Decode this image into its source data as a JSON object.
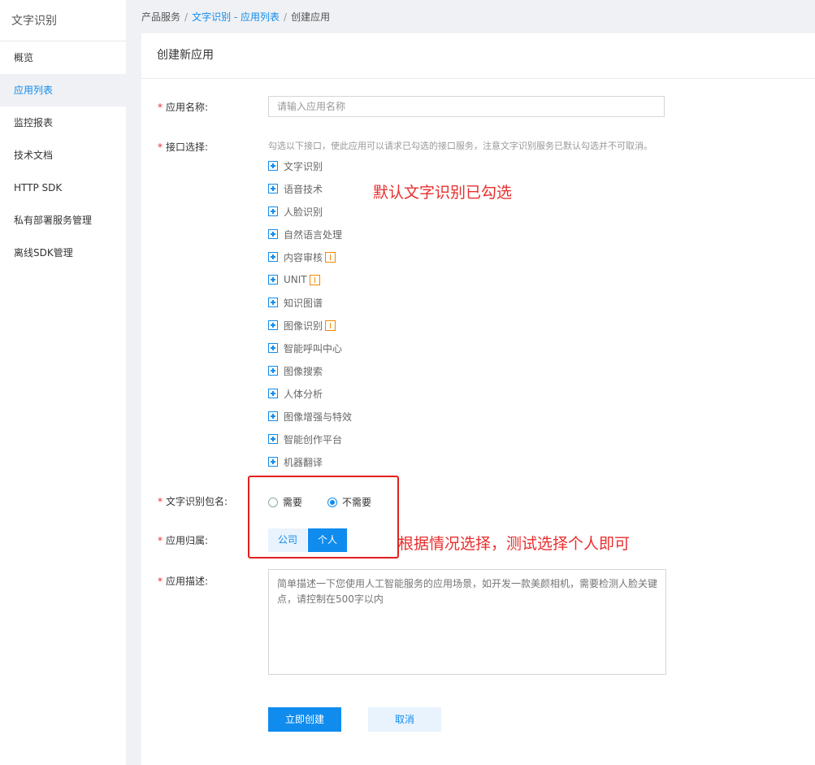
{
  "sidebar": {
    "title": "文字识别",
    "items": [
      {
        "label": "概览"
      },
      {
        "label": "应用列表"
      },
      {
        "label": "监控报表"
      },
      {
        "label": "技术文档"
      },
      {
        "label": "HTTP SDK"
      },
      {
        "label": "私有部署服务管理"
      },
      {
        "label": "离线SDK管理"
      }
    ],
    "active_index": 1
  },
  "breadcrumb": {
    "root": "产品服务",
    "link": "文字识别 - 应用列表",
    "current": "创建应用"
  },
  "form": {
    "title": "创建新应用",
    "app_name": {
      "label": "应用名称:",
      "placeholder": "请输入应用名称",
      "value": ""
    },
    "api_select": {
      "label": "接口选择:",
      "hint": "勾选以下接口，使此应用可以请求已勾选的接口服务，注意文字识别服务已默认勾选并不可取消。",
      "apis": [
        {
          "label": "文字识别",
          "tag": false
        },
        {
          "label": "语音技术",
          "tag": false
        },
        {
          "label": "人脸识别",
          "tag": false
        },
        {
          "label": "自然语言处理",
          "tag": false
        },
        {
          "label": "内容审核",
          "tag": true
        },
        {
          "label": "UNIT",
          "tag": true
        },
        {
          "label": "知识图谱",
          "tag": false
        },
        {
          "label": "图像识别",
          "tag": true
        },
        {
          "label": "智能呼叫中心",
          "tag": false
        },
        {
          "label": "图像搜索",
          "tag": false
        },
        {
          "label": "人体分析",
          "tag": false
        },
        {
          "label": "图像增强与特效",
          "tag": false
        },
        {
          "label": "智能创作平台",
          "tag": false
        },
        {
          "label": "机器翻译",
          "tag": false
        }
      ]
    },
    "package_name": {
      "label": "文字识别包名:",
      "options": [
        "需要",
        "不需要"
      ],
      "selected": "不需要"
    },
    "ownership": {
      "label": "应用归属:",
      "options": [
        "公司",
        "个人"
      ],
      "selected": "个人"
    },
    "description": {
      "label": "应用描述:",
      "placeholder": "简单描述一下您使用人工智能服务的应用场景，如开发一款美颜相机，需要检测人脸关键点，请控制在500字以内",
      "value": ""
    },
    "submit_label": "立即创建",
    "cancel_label": "取消"
  },
  "annotations": {
    "default_note": "默认文字识别已勾选",
    "choose_note": "根据情况选择，测试选择个人即可"
  },
  "colors": {
    "accent": "#108cee",
    "annotation": "#ea2e2e",
    "tag": "#f38900"
  }
}
